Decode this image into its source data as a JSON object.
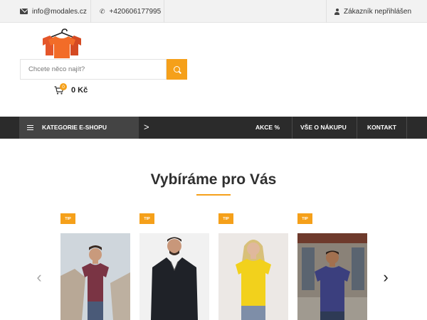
{
  "topbar": {
    "email": "info@modales.cz",
    "phone": "+420606177995",
    "account": "Zákazník nepřihlášen"
  },
  "header": {
    "search_placeholder": "Chcete něco najít?",
    "cart_count": "0",
    "cart_total": "0 Kč"
  },
  "nav": {
    "category_label": "KATEGORIE E-SHOPU",
    "category_arrow": ">",
    "links": [
      "AKCE %",
      "VŠE O NÁKUPU",
      "KONTAKT"
    ]
  },
  "section": {
    "title": "Vybíráme pro Vás",
    "prev_arrow": "‹",
    "next_arrow": "›"
  },
  "products": [
    {
      "badge": "TIP",
      "shirt_color": "#7a3444",
      "backdrop": "#cfd6dc"
    },
    {
      "badge": "TIP",
      "shirt_color": "#1f2228",
      "backdrop": "#f1f1f1"
    },
    {
      "badge": "TIP",
      "shirt_color": "#f2d11c",
      "backdrop": "#ece8e5"
    },
    {
      "badge": "TIP",
      "shirt_color": "#3b3f7e",
      "backdrop": "#8a8278"
    }
  ],
  "colors": {
    "accent": "#f5a01a",
    "nav_bg": "#2b2b2b",
    "nav_category_bg": "#444444"
  }
}
